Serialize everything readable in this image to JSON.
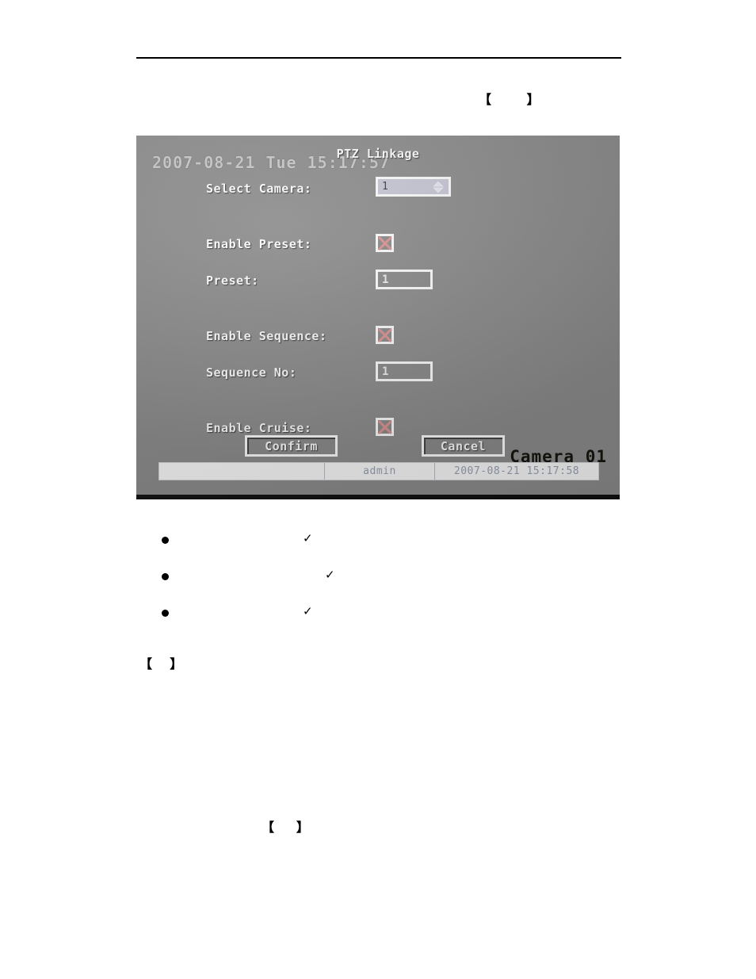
{
  "document": {
    "bracket_open": "【",
    "bracket_close": "】",
    "bracket_markers": [
      {
        "text": "【        】"
      },
      {
        "text": "【    】"
      },
      {
        "text": "【     】"
      }
    ],
    "bullets": [
      {
        "marker": "●",
        "text": "",
        "check": "✓"
      },
      {
        "marker": "●",
        "text": "",
        "check": "✓"
      },
      {
        "marker": "●",
        "text": "",
        "check": "✓"
      }
    ]
  },
  "figure": {
    "osd": {
      "datetime": "2007-08-21 Tue 15:17:57",
      "camera": "Camera 01"
    },
    "dialog": {
      "title": "PTZ Linkage",
      "rows": [
        {
          "label": "Select Camera:",
          "control": "spinner",
          "value": "1"
        },
        {
          "label": "Enable Preset:",
          "control": "checkbox",
          "value": "checked"
        },
        {
          "label": "Preset:",
          "control": "textbox",
          "value": "1"
        },
        {
          "label": "Enable Sequence:",
          "control": "checkbox",
          "value": "checked"
        },
        {
          "label": "Sequence No:",
          "control": "textbox",
          "value": "1"
        },
        {
          "label": "Enable Cruise:",
          "control": "checkbox",
          "value": "checked"
        }
      ],
      "buttons": {
        "confirm": "Confirm",
        "cancel": "Cancel"
      }
    },
    "statusbar": {
      "blank": "",
      "user": "admin",
      "datetime": "2007-08-21 15:17:58"
    },
    "colors": {
      "dialog_bg": "#8d8d8d",
      "control_border": "#ffffff",
      "checkbox_x": "#e09494",
      "spinner_fill": "#c9c9d8",
      "statusbar_bg": "#fbfbfb",
      "statusbar_text": "#9aa2b4",
      "osd_datetime": "#c9c9c9",
      "osd_camera": "#15150f"
    }
  }
}
